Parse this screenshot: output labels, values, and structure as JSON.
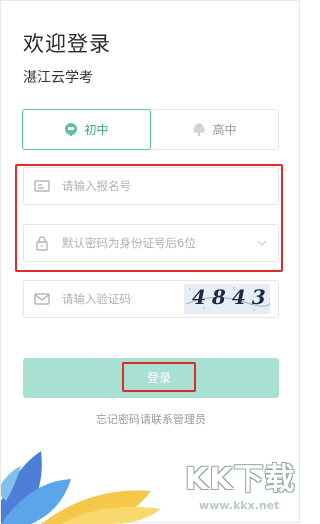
{
  "header": {
    "title": "欢迎登录",
    "subtitle": "湛江云学考"
  },
  "tabs": [
    {
      "label": "初中",
      "icon": "book-bubble-icon",
      "active": true
    },
    {
      "label": "高中",
      "icon": "tree-icon",
      "active": false
    }
  ],
  "form": {
    "registration_placeholder": "请输入报名号",
    "password_placeholder": "默认密码为身份证号后6位",
    "captcha_placeholder": "请输入验证码",
    "captcha_code": "4843"
  },
  "login_label": "登录",
  "forgot_text": "忘记密码请联系管理员",
  "watermark": {
    "letters": "KK下载",
    "url": "www.kkx.net"
  },
  "colors": {
    "accent": "#59c3a4",
    "button": "#a8e0d2",
    "highlight": "#e02b2b"
  }
}
